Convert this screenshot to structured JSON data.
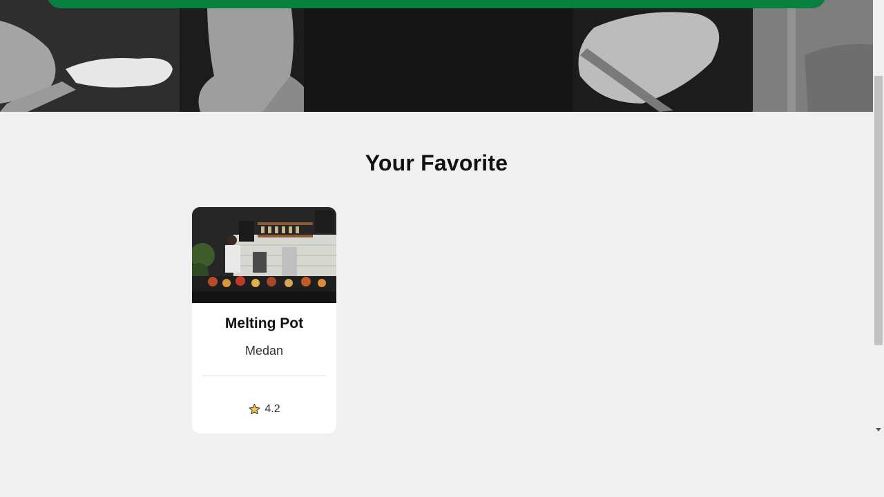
{
  "hero": {
    "image_description_icon": "hero-dining-photo"
  },
  "favorites": {
    "title": "Your Favorite",
    "items": [
      {
        "name": "Melting Pot",
        "city": "Medan",
        "rating": "4.2",
        "rating_icon": "star-icon"
      }
    ]
  },
  "colors": {
    "accent_green": "#07803f",
    "background": "#f0f0f0",
    "card": "#ffffff",
    "star": "#f2c84b"
  }
}
